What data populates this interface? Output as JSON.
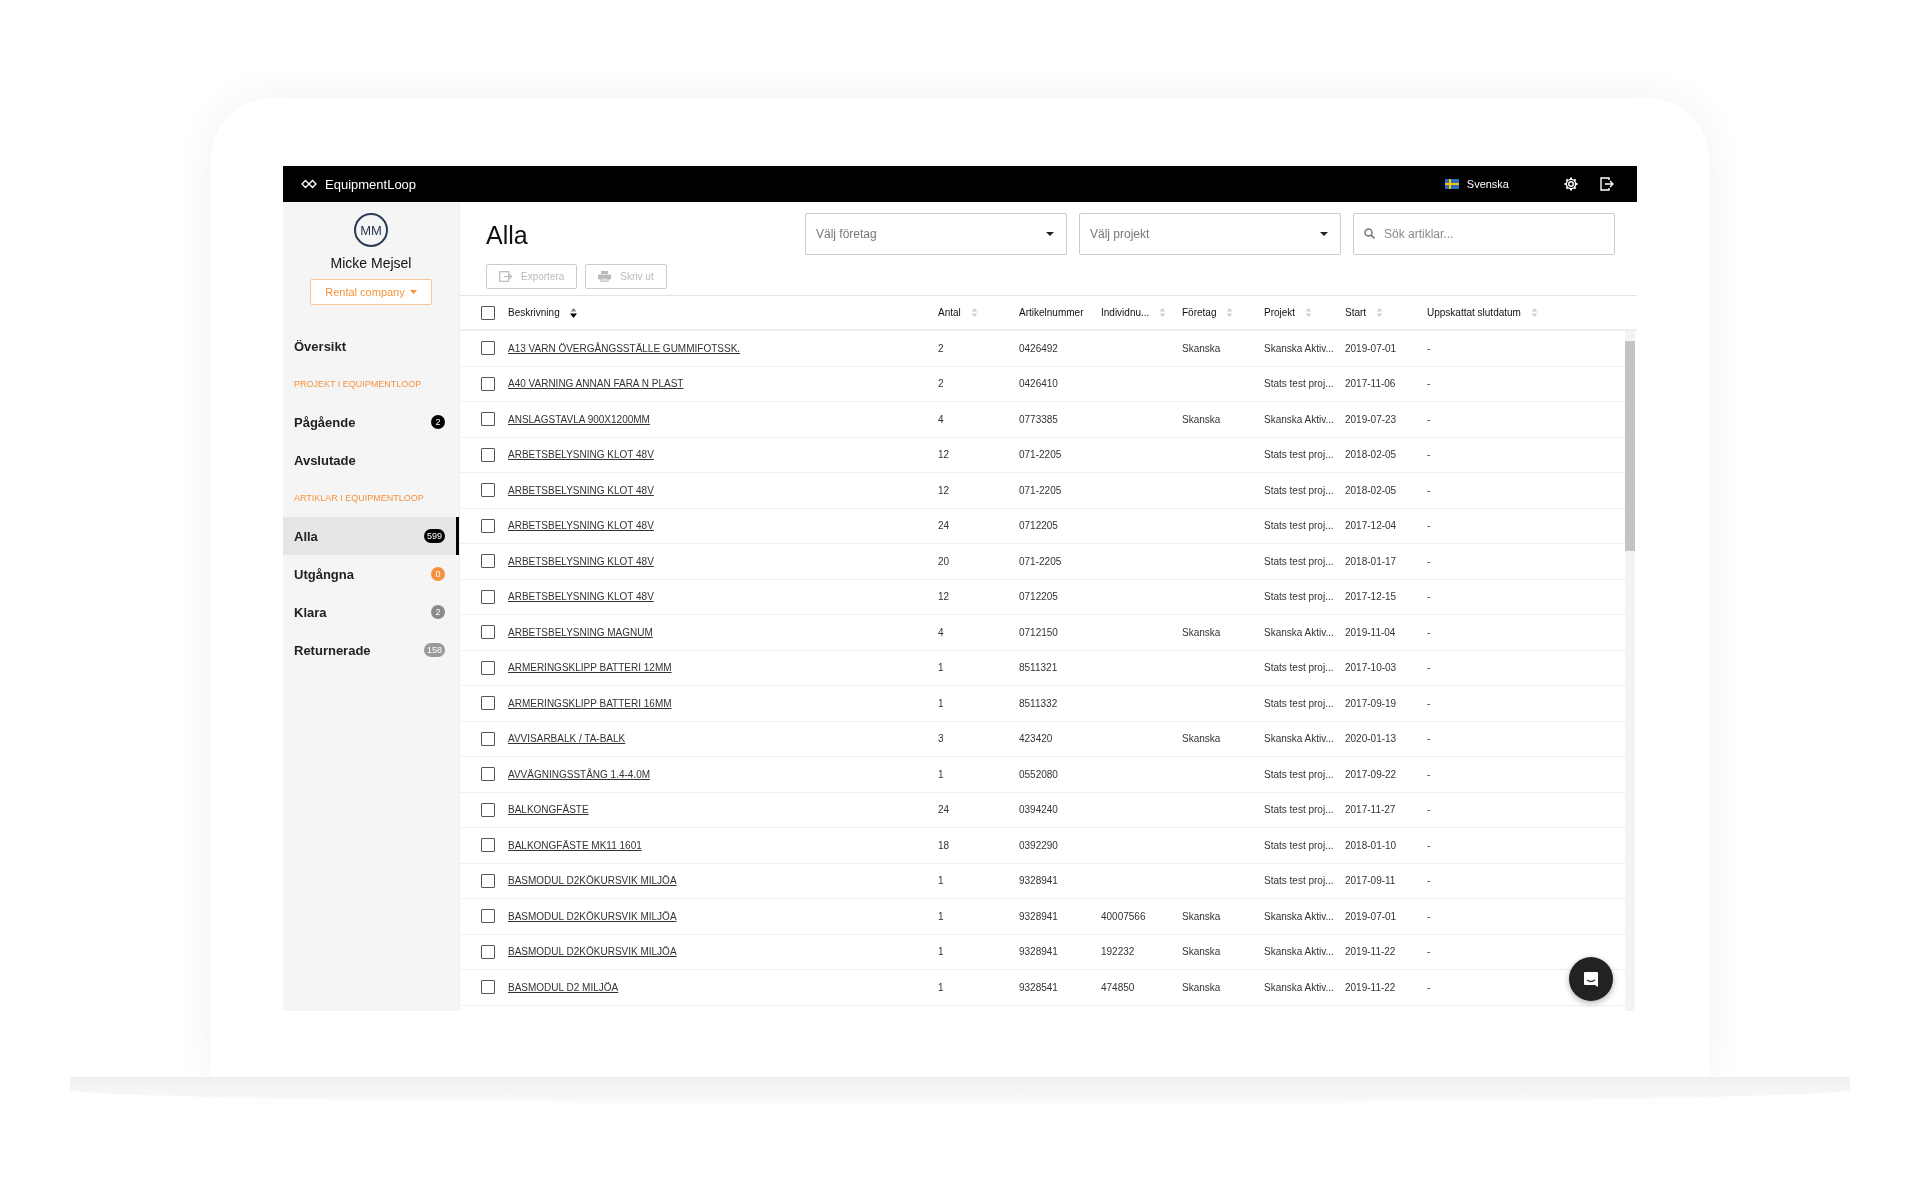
{
  "topbar": {
    "brand": "EquipmentLoop",
    "language": "Svenska"
  },
  "sidebar": {
    "avatar": "MM",
    "user": "Micke Mejsel",
    "company": "Rental company",
    "items": [
      {
        "kind": "link",
        "label": "Översikt",
        "selected": false
      },
      {
        "kind": "section",
        "label": "PROJEKT I EQUIPMENTLOOP"
      },
      {
        "kind": "link",
        "label": "Pågående",
        "selected": false,
        "badge": "2",
        "color": "#000000"
      },
      {
        "kind": "link",
        "label": "Avslutade",
        "selected": false
      },
      {
        "kind": "section",
        "label": "ARTIKLAR I EQUIPMENTLOOP"
      },
      {
        "kind": "link",
        "label": "Alla",
        "selected": true,
        "badge": "599",
        "color": "#000000"
      },
      {
        "kind": "link",
        "label": "Utgångna",
        "selected": false,
        "badge": "0",
        "color": "#f5923e"
      },
      {
        "kind": "link",
        "label": "Klara",
        "selected": false,
        "badge": "2",
        "color": "#8a8a8a"
      },
      {
        "kind": "link",
        "label": "Returnerade",
        "selected": false,
        "badge": "158",
        "color": "#9a9a9a"
      }
    ]
  },
  "page": {
    "title": "Alla",
    "company_select": {
      "placeholder": "Välj företag"
    },
    "project_select": {
      "placeholder": "Välj projekt"
    },
    "search": {
      "placeholder": "Sök artiklar..."
    },
    "actions": [
      {
        "label": "Exportera",
        "kind": "export",
        "disabled": true
      },
      {
        "label": "Skriv ut",
        "kind": "print",
        "disabled": true
      }
    ]
  },
  "table": {
    "select_all": {
      "checked": false
    },
    "columns": [
      {
        "label": "Beskrivning",
        "sortable": true,
        "sorted": true
      },
      {
        "label": "Antal",
        "sortable": true,
        "sorted": false
      },
      {
        "label": "Artikelnummer",
        "sortable": false
      },
      {
        "label": "Individnu...",
        "sortable": true,
        "sorted": false
      },
      {
        "label": "Företag",
        "sortable": true,
        "sorted": false
      },
      {
        "label": "Projekt",
        "sortable": true,
        "sorted": false
      },
      {
        "label": "Start",
        "sortable": true,
        "sorted": false
      },
      {
        "label": "Uppskattat slutdatum",
        "sortable": true,
        "sorted": false
      }
    ],
    "rows": [
      {
        "checked": false,
        "cells": [
          "A13 VARN ÖVERGÅNGSSTÄLLE GUMMIFOTSSK.",
          "2",
          "0426492",
          "",
          "Skanska",
          "Skanska Aktiv...",
          "2019-07-01",
          "-"
        ]
      },
      {
        "checked": false,
        "cells": [
          "A40 VARNING ANNAN FARA N PLAST",
          "2",
          "0426410",
          "",
          "",
          "Stats test proj...",
          "2017-11-06",
          "-"
        ]
      },
      {
        "checked": false,
        "cells": [
          "ANSLAGSTAVLA 900X1200MM",
          "4",
          "0773385",
          "",
          "Skanska",
          "Skanska Aktiv...",
          "2019-07-23",
          "-"
        ]
      },
      {
        "checked": false,
        "cells": [
          "ARBETSBELYSNING KLOT 48V",
          "12",
          "071-2205",
          "",
          "",
          "Stats test proj...",
          "2018-02-05",
          "-"
        ]
      },
      {
        "checked": false,
        "cells": [
          "ARBETSBELYSNING KLOT 48V",
          "12",
          "071-2205",
          "",
          "",
          "Stats test proj...",
          "2018-02-05",
          "-"
        ]
      },
      {
        "checked": false,
        "cells": [
          "ARBETSBELYSNING KLOT 48V",
          "24",
          "0712205",
          "",
          "",
          "Stats test proj...",
          "2017-12-04",
          "-"
        ]
      },
      {
        "checked": false,
        "cells": [
          "ARBETSBELYSNING KLOT 48V",
          "20",
          "071-2205",
          "",
          "",
          "Stats test proj...",
          "2018-01-17",
          "-"
        ]
      },
      {
        "checked": false,
        "cells": [
          "ARBETSBELYSNING KLOT 48V",
          "12",
          "0712205",
          "",
          "",
          "Stats test proj...",
          "2017-12-15",
          "-"
        ]
      },
      {
        "checked": false,
        "cells": [
          "ARBETSBELYSNING MAGNUM",
          "4",
          "0712150",
          "",
          "Skanska",
          "Skanska Aktiv...",
          "2019-11-04",
          "-"
        ]
      },
      {
        "checked": false,
        "cells": [
          "ARMERINGSKLIPP BATTERI 12MM",
          "1",
          "8511321",
          "",
          "",
          "Stats test proj...",
          "2017-10-03",
          "-"
        ]
      },
      {
        "checked": false,
        "cells": [
          "ARMERINGSKLIPP BATTERI 16MM",
          "1",
          "8511332",
          "",
          "",
          "Stats test proj...",
          "2017-09-19",
          "-"
        ]
      },
      {
        "checked": false,
        "cells": [
          "AVVISARBALK / TA-BALK",
          "3",
          "423420",
          "",
          "Skanska",
          "Skanska Aktiv...",
          "2020-01-13",
          "-"
        ]
      },
      {
        "checked": false,
        "cells": [
          "AVVÄGNINGSSTÅNG 1.4-4.0M",
          "1",
          "0552080",
          "",
          "",
          "Stats test proj...",
          "2017-09-22",
          "-"
        ]
      },
      {
        "checked": false,
        "cells": [
          "BALKONGFÄSTE",
          "24",
          "0394240",
          "",
          "",
          "Stats test proj...",
          "2017-11-27",
          "-"
        ]
      },
      {
        "checked": false,
        "cells": [
          "BALKONGFÄSTE MK11 1601",
          "18",
          "0392290",
          "",
          "",
          "Stats test proj...",
          "2018-01-10",
          "-"
        ]
      },
      {
        "checked": false,
        "cells": [
          "BASMODUL D2KÖKURSVIK MILJÖA",
          "1",
          "9328941",
          "",
          "",
          "Stats test proj...",
          "2017-09-11",
          "-"
        ]
      },
      {
        "checked": false,
        "cells": [
          "BASMODUL D2KÖKURSVIK MILJÖA",
          "1",
          "9328941",
          "40007566",
          "Skanska",
          "Skanska Aktiv...",
          "2019-07-01",
          "-"
        ]
      },
      {
        "checked": false,
        "cells": [
          "BASMODUL D2KÖKURSVIK MILJÖA",
          "1",
          "9328941",
          "192232",
          "Skanska",
          "Skanska Aktiv...",
          "2019-11-22",
          "-"
        ]
      },
      {
        "checked": false,
        "cells": [
          "BASMODUL D2 MILJÖA",
          "1",
          "9328541",
          "474850",
          "Skanska",
          "Skanska Aktiv...",
          "2019-11-22",
          "-"
        ]
      }
    ]
  }
}
